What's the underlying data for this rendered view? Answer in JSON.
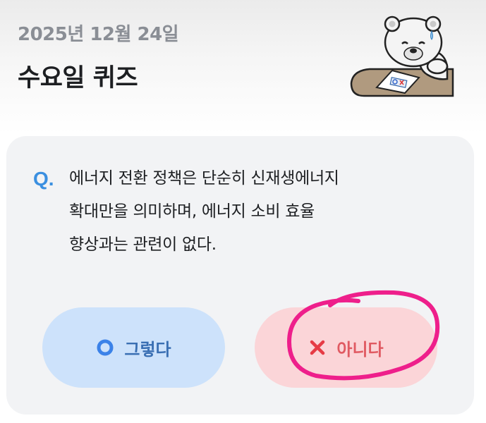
{
  "header": {
    "date": "2025년 12월 24일",
    "title": "수요일 퀴즈",
    "mascot_icon": "bear-mascot-with-ox-card-icon"
  },
  "quiz": {
    "q_mark": "Q.",
    "question_lines": [
      "에너지 전환 정책은 단순히 신재생에너지",
      "확대만을 의미하며, 에너지 소비 효율",
      "향상과는 관련이 없다."
    ],
    "answers": {
      "yes": {
        "label": "그렇다",
        "icon": "circle-o-icon",
        "color": "#3b82e8"
      },
      "no": {
        "label": "아니다",
        "icon": "x-mark-icon",
        "color": "#e63b45"
      }
    },
    "selection_annotation_color": "#ee1f8b"
  }
}
